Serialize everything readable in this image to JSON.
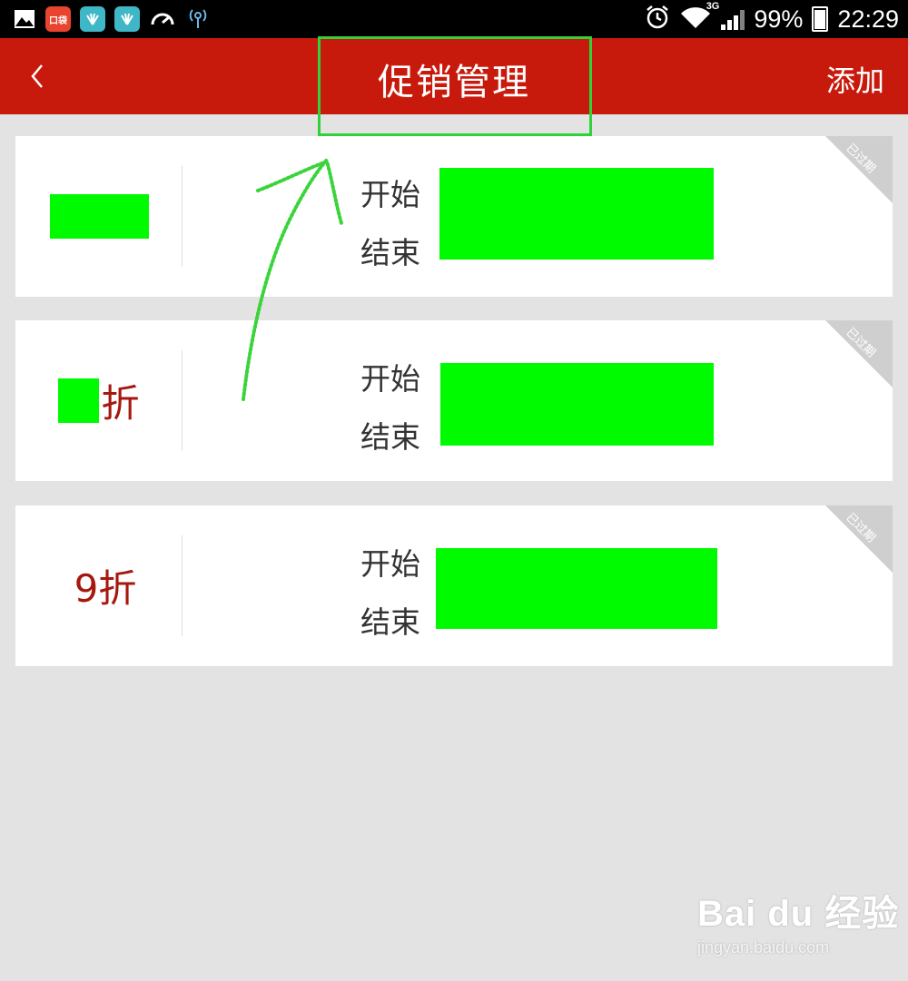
{
  "status_bar": {
    "battery": "99%",
    "time": "22:29",
    "network": "3G",
    "icons": [
      "gallery-icon",
      "koudai-icon",
      "huawei-icon",
      "huawei-icon",
      "speedometer-icon",
      "wifi-hotspot-icon",
      "alarm-icon",
      "wifi-icon",
      "signal-icon",
      "battery-icon"
    ],
    "koudai_label": "口袋"
  },
  "header": {
    "title": "促销管理",
    "add_label": "添加",
    "back_icon": "chevron-left-icon",
    "bg_color": "#c81a0c"
  },
  "promotions": [
    {
      "discount": "",
      "start_label": "开始",
      "end_label": "结束",
      "badge": "已过期"
    },
    {
      "discount": "折",
      "start_label": "开始",
      "end_label": "结束",
      "badge": "已过期"
    },
    {
      "discount": "9折",
      "start_label": "开始",
      "end_label": "结束",
      "badge": "已过期"
    }
  ],
  "watermark": {
    "brand": "Bai du 经验",
    "url": "jingyan.baidu.com"
  },
  "colors": {
    "accent_red": "#c81a0c",
    "discount_text": "#a5180d",
    "annotation_green": "#2fd23a",
    "mask_green": "#00fa00"
  }
}
